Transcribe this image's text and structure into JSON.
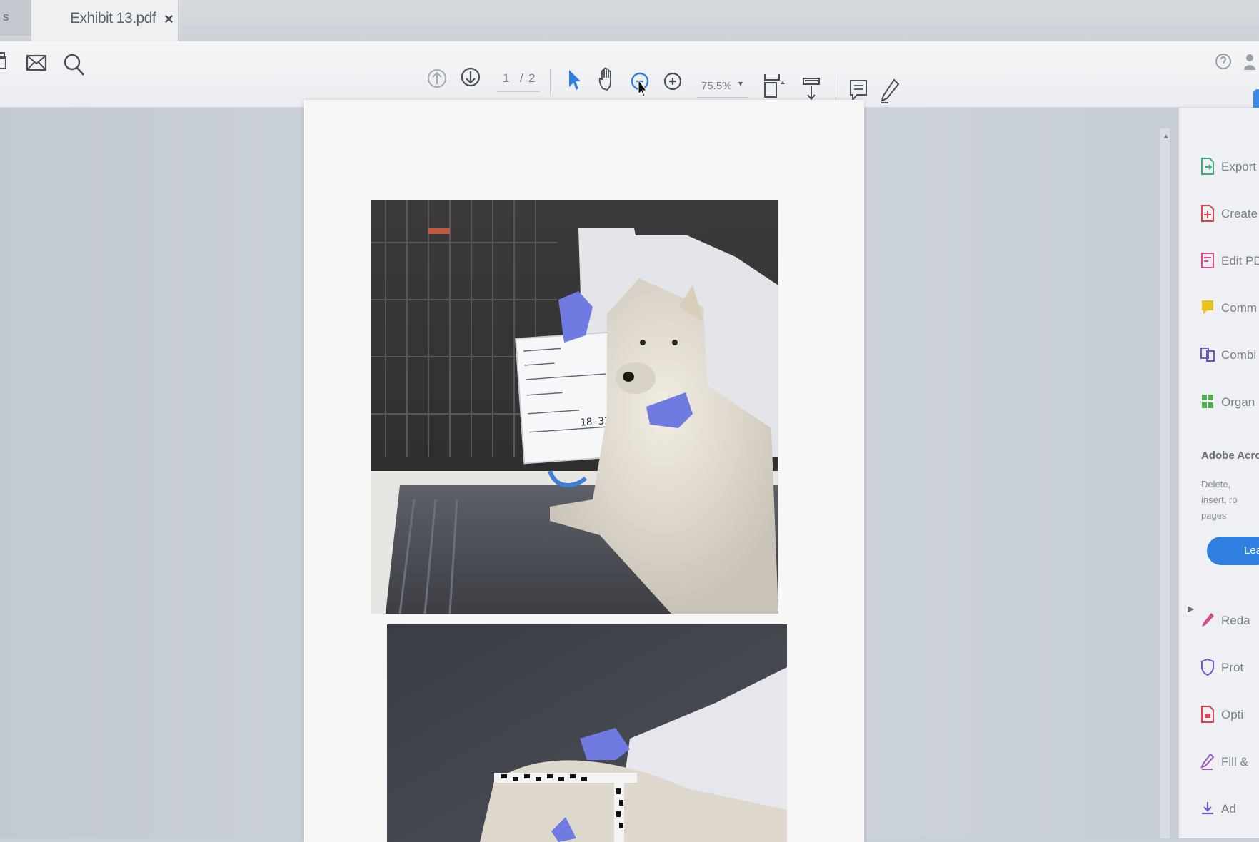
{
  "tabs": {
    "previous_label": "s",
    "active_title": "Exhibit 13.pdf",
    "close_label": "×"
  },
  "toolbar": {
    "left_icons": [
      "print-icon",
      "email-icon",
      "search-icon"
    ],
    "page_current": "1",
    "page_separator": "/",
    "page_total": "2",
    "zoom_value": "75.5%",
    "zoom_caret": "▾",
    "icons": [
      "prev-page-icon",
      "next-page-icon",
      "select-arrow-icon",
      "hand-icon",
      "zoom-out-icon",
      "zoom-in-icon",
      "fit-page-icon",
      "scroll-mode-icon",
      "comment-icon",
      "pen-icon"
    ],
    "right_icons": [
      "help-icon",
      "account-icon"
    ]
  },
  "document": {
    "photo1_sign": {
      "case_number": "18-323"
    }
  },
  "right_panel": {
    "tools": [
      {
        "label": "Export P",
        "icon": "export-pdf-icon",
        "color": "#3fae7a"
      },
      {
        "label": "Create F",
        "icon": "create-pdf-icon",
        "color": "#e0404a"
      },
      {
        "label": "Edit PDI",
        "icon": "edit-pdf-icon",
        "color": "#d9488a"
      },
      {
        "label": "Comm",
        "icon": "comment-tool-icon",
        "color": "#e8c21a"
      },
      {
        "label": "Combi",
        "icon": "combine-icon",
        "color": "#6a5acd"
      },
      {
        "label": "Organ",
        "icon": "organize-icon",
        "color": "#4cae4c"
      }
    ],
    "promo_heading": "Adobe Acrob",
    "promo_desc": "Delete, insert, ro pages",
    "learn_button": "Lea",
    "tools2": [
      {
        "label": "Reda",
        "icon": "redact-icon",
        "color": "#d9488a"
      },
      {
        "label": "Prot",
        "icon": "protect-icon",
        "color": "#6a5acd"
      },
      {
        "label": "Opti",
        "icon": "optimize-icon",
        "color": "#e0404a"
      },
      {
        "label": "Fill &",
        "icon": "fill-sign-icon",
        "color": "#9b59b6"
      },
      {
        "label": "Ad",
        "icon": "add-icon",
        "color": "#6a5acd"
      }
    ]
  },
  "colors": {
    "accent_blue": "#2f80e0",
    "glove_blue": "#6f7be0"
  }
}
